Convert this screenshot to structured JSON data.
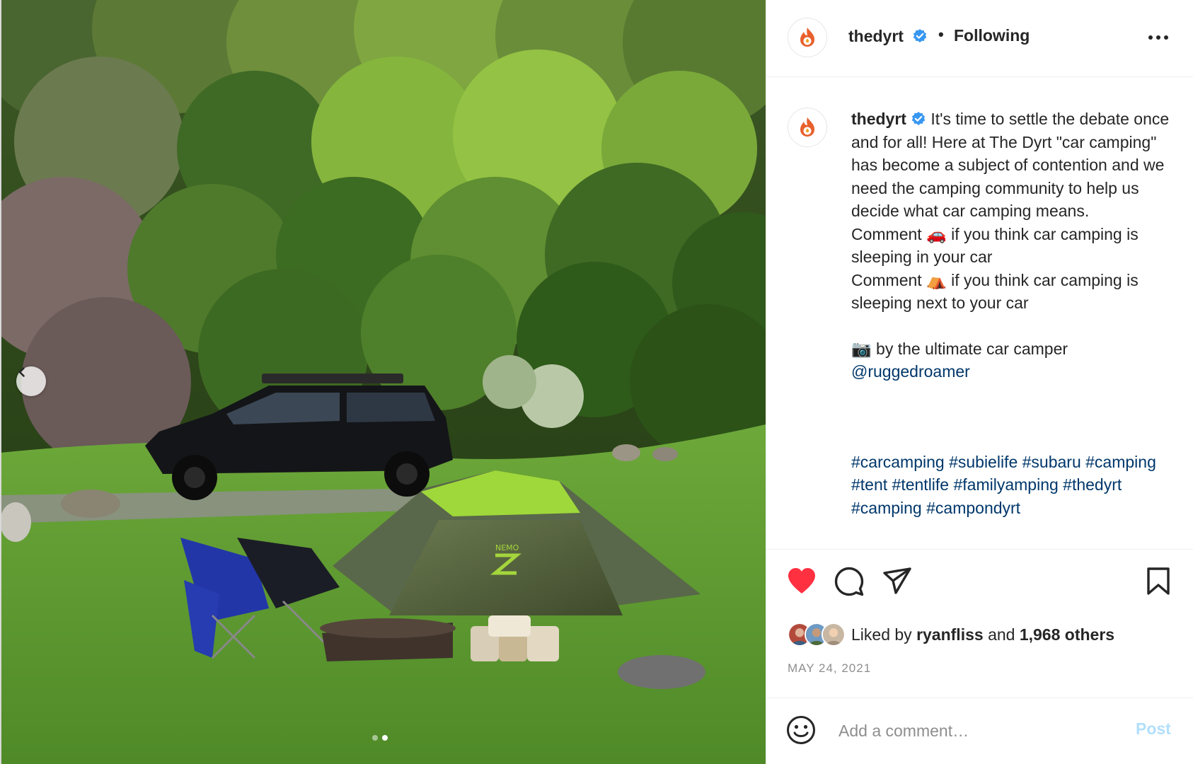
{
  "post": {
    "username": "thedyrt",
    "follow_state": "Following",
    "separator": "•",
    "caption": {
      "intro": " It's time to settle the debate once and for all! Here at The Dyrt \"car camping\" has become a subject of contention and we need the camping community to help us decide what car camping means.",
      "line_car": "Comment 🚗 if you think car camping is sleeping in your car",
      "line_tent": "Comment ⛺ if you think car camping is sleeping next to your car",
      "photo_credit": "📷 by the ultimate car camper",
      "mention": "@ruggedroamer",
      "hashtags": "#carcamping #subielife #subaru #camping #tent #tentlife #familyamping #thedyrt #camping #campondyrt"
    },
    "likes": {
      "prefix": "Liked by",
      "liker": "ryanfliss",
      "conjunction": "and",
      "others": "1,968 others"
    },
    "date": "MAY 24, 2021",
    "carousel": {
      "slide_count": 2,
      "active_index": 1
    }
  },
  "comment_box": {
    "placeholder": "Add a comment…",
    "post_label": "Post"
  },
  "icons": {
    "like": "heart-filled-icon",
    "comment": "comment-icon",
    "share": "send-icon",
    "save": "bookmark-icon",
    "more": "more-options-icon",
    "emoji": "emoji-icon",
    "prev": "chevron-left-icon",
    "verified": "verified-badge-icon",
    "brand": "campfire-logo-icon"
  },
  "colors": {
    "like_red": "#ff3040",
    "verified_blue": "#3897f0",
    "link_blue": "#00376b",
    "post_button_disabled": "#b2dffc",
    "brand_orange": "#e8602c"
  }
}
